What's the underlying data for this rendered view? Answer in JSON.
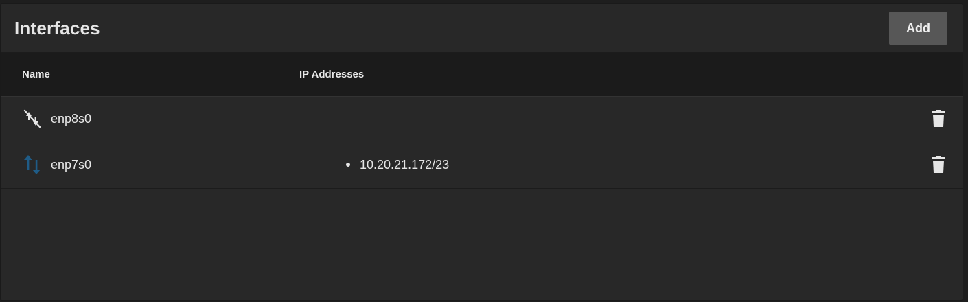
{
  "card": {
    "title": "Interfaces",
    "add_label": "Add"
  },
  "table": {
    "columns": [
      "Name",
      "IP Addresses"
    ],
    "rows": [
      {
        "name": "enp8s0",
        "icon": "link-off-icon",
        "ip_addresses": [],
        "status_color": "#e6e6e6"
      },
      {
        "name": "enp7s0",
        "icon": "swap-vertical-icon",
        "ip_addresses": [
          "10.20.21.172/23"
        ],
        "status_color": "#1f5c87"
      }
    ]
  },
  "colors": {
    "background": "#282828",
    "header_bg": "#1b1b1b",
    "button_bg": "#575757",
    "accent_link_up": "#1f5c87"
  }
}
